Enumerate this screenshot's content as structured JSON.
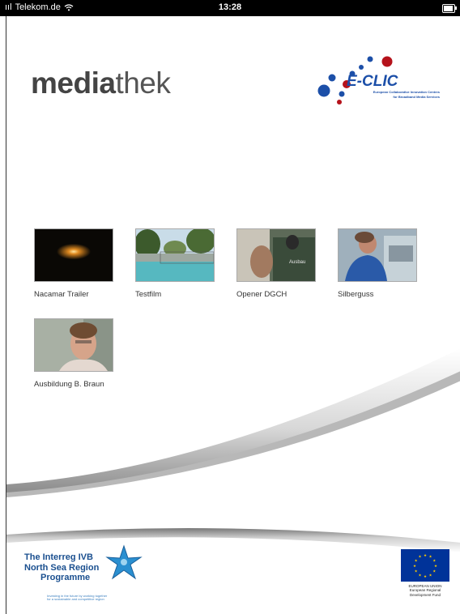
{
  "status_bar": {
    "carrier": "Telekom.de",
    "time": "13:28"
  },
  "header": {
    "brand_bold": "media",
    "brand_light": "thek",
    "partner_logo": {
      "name": "E-CLIC",
      "tagline_1": "European Collaborative Innovation Centres",
      "tagline_2": "for Broadband Media Services"
    }
  },
  "videos": [
    {
      "title": "Nacamar Trailer",
      "thumb_overlay": ""
    },
    {
      "title": "Testfilm",
      "thumb_overlay": ""
    },
    {
      "title": "Opener DGCH",
      "thumb_overlay": "Ausbau"
    },
    {
      "title": "Silberguss",
      "thumb_overlay": ""
    },
    {
      "title": "Ausbildung B. Braun",
      "thumb_overlay": ""
    }
  ],
  "footer": {
    "interreg": {
      "line1": "The Interreg IVB",
      "line2": "North Sea Region",
      "line3": "Programme",
      "small1": "Investing in the future by working together",
      "small2": "for a sustainable and competitive region"
    },
    "eu": {
      "line1": "EUROPEAN UNION",
      "line2": "European Regional",
      "line3": "Development Fund"
    }
  },
  "colors": {
    "brand_text": "#555555",
    "eclic_blue": "#1c4fa8",
    "eclic_red": "#b5121b",
    "eu_blue": "#003399",
    "eu_gold": "#ffcc00",
    "interreg_blue": "#1a4f8f"
  }
}
